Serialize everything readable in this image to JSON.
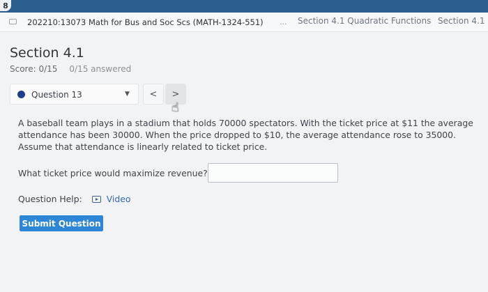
{
  "app": {
    "badge": "8"
  },
  "breadcrumb": {
    "course": "202210:13073 Math for Bus and Soc Scs (MATH-1324-551)",
    "ellipsis": "...",
    "section": "Section 4.1 Quadratic Functions",
    "section_short": "Section 4.1"
  },
  "page": {
    "title": "Section 4.1",
    "score": "Score: 0/15",
    "answered": "0/15 answered"
  },
  "question_nav": {
    "current": "Question 13",
    "prev_label": "<",
    "next_label": ">"
  },
  "question": {
    "text": "A baseball team plays in a stadium that holds 70000 spectators. With the ticket price at $11 the average attendance has been 30000. When the price dropped to $10, the average attendance rose to 35000. Assume that attendance is linearly related to ticket price.",
    "prompt": "What ticket price would maximize revenue? $",
    "answer_value": ""
  },
  "help": {
    "label": "Question Help:",
    "video_label": "Video"
  },
  "submit_label": "Submit Question",
  "colors": {
    "topbar": "#2c5f8f",
    "submit": "#2e86d6",
    "question_dot": "#1c3f8c",
    "link": "#3567b0"
  }
}
